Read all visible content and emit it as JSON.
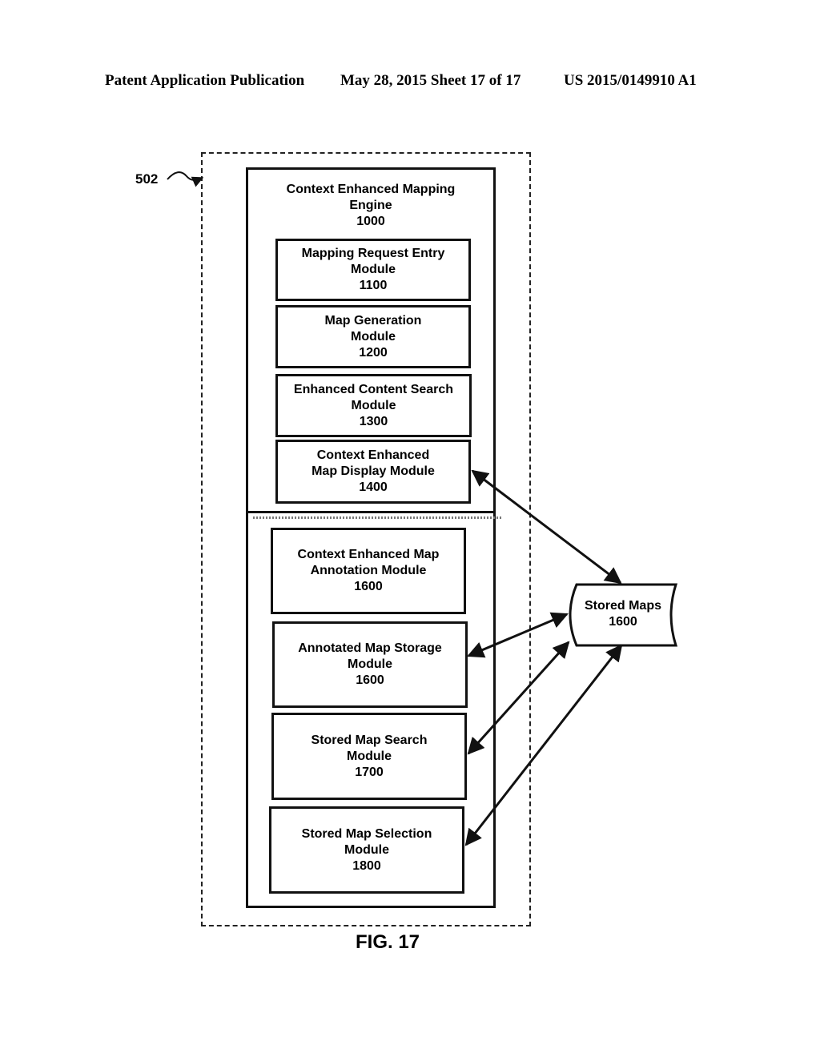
{
  "header": {
    "publication": "Patent Application Publication",
    "date_sheet": "May 28, 2015  Sheet 17 of 17",
    "patent_number": "US 2015/0149910 A1"
  },
  "reference_label": "502",
  "engine": {
    "title_line1": "Context Enhanced Mapping",
    "title_line2": "Engine",
    "number": "1000"
  },
  "modules": [
    {
      "line1": "Mapping Request Entry",
      "line2": "Module",
      "number": "1100"
    },
    {
      "line1": "Map Generation",
      "line2": "Module",
      "number": "1200"
    },
    {
      "line1": "Enhanced Content Search",
      "line2": "Module",
      "number": "1300"
    },
    {
      "line1": "Context Enhanced",
      "line2": "Map Display Module",
      "number": "1400"
    },
    {
      "line1": "Context Enhanced Map",
      "line2": "Annotation Module",
      "number": "1600"
    },
    {
      "line1": "Annotated Map Storage",
      "line2": "Module",
      "number": "1600"
    },
    {
      "line1": "Stored Map Search",
      "line2": "Module",
      "number": "1700"
    },
    {
      "line1": "Stored Map Selection",
      "line2": "Module",
      "number": "1800"
    }
  ],
  "storage": {
    "label": "Stored Maps",
    "number": "1600"
  },
  "figure_caption": "FIG. 17"
}
